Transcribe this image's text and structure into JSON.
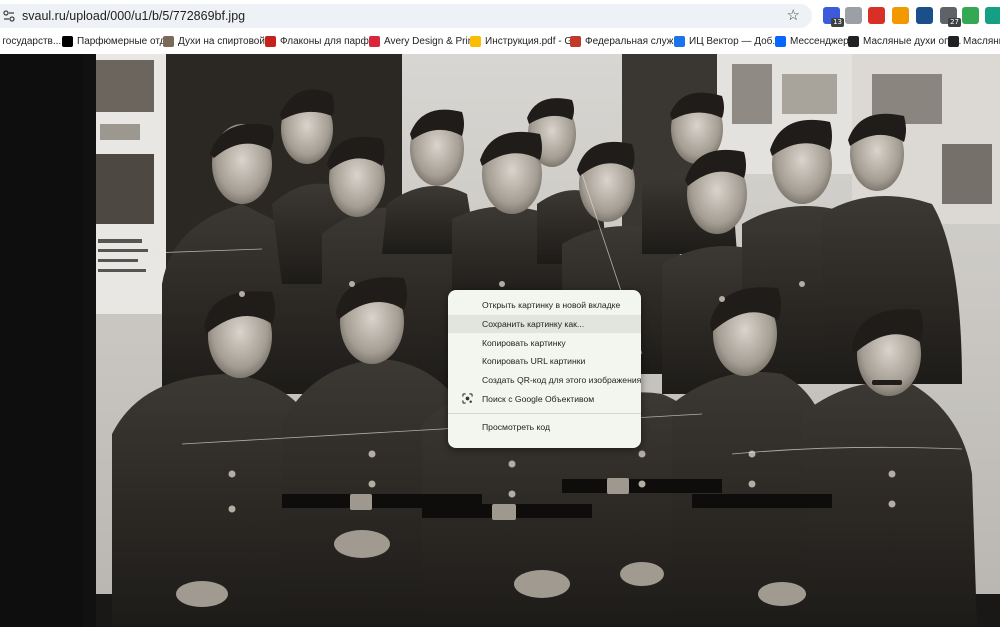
{
  "address_bar": {
    "url": "svaul.ru/upload/000/u1/b/5/772869bf.jpg"
  },
  "toolbar": {
    "extensions": [
      {
        "icon": "house-extension-icon",
        "color": "#3b5bdb",
        "badge": "13"
      },
      {
        "icon": "mouse-extension-icon",
        "color": "#9aa0a6",
        "badge": ""
      },
      {
        "icon": "adobe-acrobat-icon",
        "color": "#d93025",
        "badge": ""
      },
      {
        "icon": "fire-extension-icon",
        "color": "#f29900",
        "badge": ""
      },
      {
        "icon": "checkbox-extension-icon",
        "color": "#1a4f8b",
        "badge": ""
      },
      {
        "icon": "bag-extension-icon",
        "color": "#5f6368",
        "badge": "27"
      },
      {
        "icon": "green-circle-extension-icon",
        "color": "#34a853",
        "badge": ""
      },
      {
        "icon": "grammarly-extension-icon",
        "color": "#15a085",
        "badge": ""
      }
    ]
  },
  "bookmarks": [
    {
      "label": "о государств...",
      "icon": "none",
      "color": "#ffffff"
    },
    {
      "label": "Парфюмерные отд...",
      "icon": "y-logo-icon",
      "color": "#000000"
    },
    {
      "label": "Духи на спиртовой...",
      "icon": "photo-favicon-icon",
      "color": "#7a6a58"
    },
    {
      "label": "Флаконы для парф...",
      "icon": "pdf-favicon-icon",
      "color": "#c5221f"
    },
    {
      "label": "Avery Design & Prin...",
      "icon": "avery-favicon-icon",
      "color": "#d7263d"
    },
    {
      "label": "Инструкция.pdf - G...",
      "icon": "google-drive-icon",
      "color": "#fbbc04"
    },
    {
      "label": "Федеральная служ...",
      "icon": "fedslugba-favicon-icon",
      "color": "#c0392b"
    },
    {
      "label": "ИЦ Вектор — Доб...",
      "icon": "vector-favicon-icon",
      "color": "#1a73e8"
    },
    {
      "label": "Мессенджер",
      "icon": "messenger-icon",
      "color": "#0866ff"
    },
    {
      "label": "Масляные духи опт...",
      "icon": "dark-square-favicon-icon",
      "color": "#202124"
    },
    {
      "label": "Масляные",
      "icon": "dark-square-favicon-icon",
      "color": "#202124"
    }
  ],
  "context_menu": {
    "items": [
      {
        "label": "Открыть картинку в новой вкладке",
        "highlighted": false
      },
      {
        "label": "Сохранить картинку как...",
        "highlighted": true
      },
      {
        "label": "Копировать картинку",
        "highlighted": false
      },
      {
        "label": "Копировать URL картинки",
        "highlighted": false
      },
      {
        "label": "Создать QR-код для этого изображения",
        "highlighted": false
      },
      {
        "label": "Поиск с Google Объективом",
        "highlighted": false,
        "icon": "google-lens-icon"
      },
      {
        "label": "Просмотреть код",
        "highlighted": false
      }
    ]
  },
  "colors": {
    "chrome_bg": "#ffffff",
    "omnibox_bg": "#eef1f6",
    "menu_bg": "#f3f6ef",
    "menu_highlight": "#e2e5de",
    "photo_tone": "#3a3530"
  }
}
